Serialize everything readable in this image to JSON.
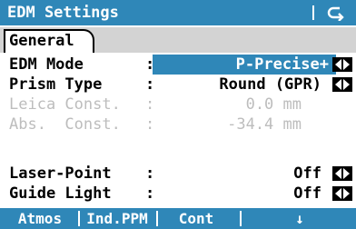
{
  "title": "EDM Settings",
  "tab": "General",
  "fields": [
    {
      "label": "EDM Mode",
      "value": "P-Precise+",
      "selected": true,
      "disabled": false
    },
    {
      "label": "Prism Type",
      "value": "Round (GPR)",
      "selected": false,
      "disabled": false
    },
    {
      "label": "Leica Const.",
      "value": "0.0 mm",
      "selected": false,
      "disabled": true
    },
    {
      "label": "Abs.  Const.",
      "value": "-34.4 mm",
      "selected": false,
      "disabled": true
    },
    {
      "label": "Laser-Point",
      "value": "Off",
      "selected": false,
      "disabled": false
    },
    {
      "label": "Guide Light",
      "value": "Off",
      "selected": false,
      "disabled": false
    }
  ],
  "colon": ":",
  "softkeys": [
    "Atmos",
    "Ind.PPM",
    "Cont",
    "↓"
  ],
  "colors": {
    "accent": "#2f87b8",
    "disabled_text": "#bdbdbd",
    "tab_bar": "#d3d3d3"
  },
  "icons": {
    "back": "return-arrow-icon",
    "scroll": "left-right-arrows-icon"
  }
}
